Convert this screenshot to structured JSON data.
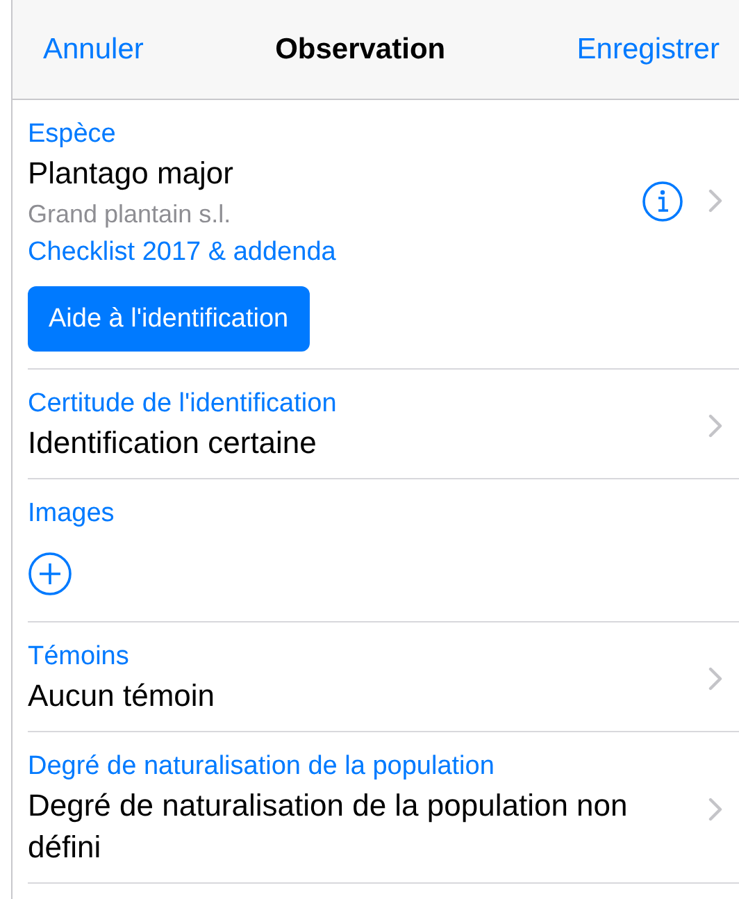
{
  "nav": {
    "cancel": "Annuler",
    "title": "Observation",
    "save": "Enregistrer"
  },
  "sections": [
    {
      "kind": "species",
      "label": "Espèce",
      "value": "Plantago major",
      "common_name": "Grand plantain s.l.",
      "checklist": "Checklist 2017 & addenda",
      "button": "Aide à l'identification"
    },
    {
      "kind": "detail",
      "label": "Certitude de l'identification",
      "value": "Identification certaine"
    },
    {
      "kind": "images",
      "label": "Images"
    },
    {
      "kind": "detail",
      "label": "Témoins",
      "value": "Aucun témoin"
    },
    {
      "kind": "detail",
      "label": "Degré de naturalisation de la population",
      "value": "Degré de naturalisation de la population non défini"
    }
  ]
}
